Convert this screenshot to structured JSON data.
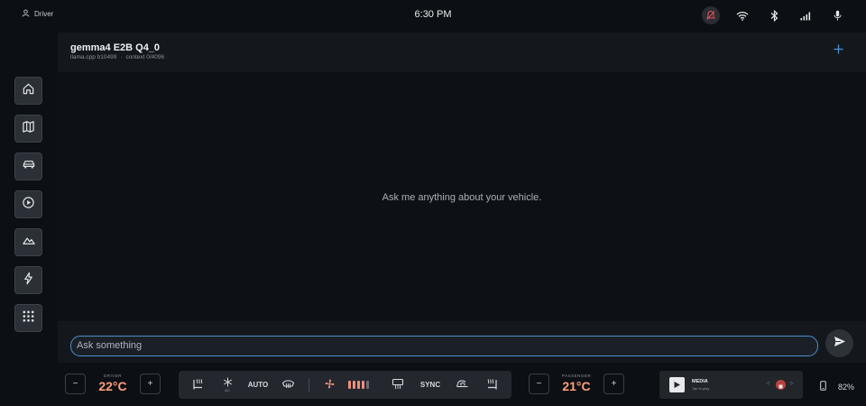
{
  "status": {
    "driver_label": "Driver",
    "time": "6:30 PM",
    "icons": [
      "user-icon",
      "alert-icon",
      "wifi-icon",
      "bluetooth-icon",
      "signal-icon",
      "mic-icon"
    ]
  },
  "sidebar": {
    "items": [
      {
        "icon": "home-icon"
      },
      {
        "icon": "map-icon"
      },
      {
        "icon": "car-icon"
      },
      {
        "icon": "play-icon"
      },
      {
        "icon": "mountain-icon"
      },
      {
        "icon": "bolt-icon"
      },
      {
        "icon": "apps-grid-icon"
      }
    ]
  },
  "chat": {
    "model_name": "gemma4 E2B Q4_0",
    "engine": "llama.cpp b10499",
    "separator": "·",
    "context": "context 0/4096",
    "empty_message": "Ask me anything about your vehicle.",
    "input_placeholder": "Ask something"
  },
  "climate": {
    "driver_label": "DRIVER",
    "driver_temp": "22°C",
    "passenger_label": "PASSENGER",
    "passenger_temp": "21°C",
    "minus": "−",
    "plus": "+",
    "auto_label": "AUTO",
    "sync_label": "SYNC",
    "ac_label": "A/C",
    "fan_level": 4,
    "fan_max": 5,
    "accent_color": "#ff9f7a"
  },
  "media": {
    "title": "MEDIA",
    "subtitle": "Tap to play",
    "prev": "◁",
    "next": "▷"
  },
  "battery": {
    "percent": "82%"
  },
  "colors": {
    "accent_blue": "#4a8fd0",
    "alert_red": "#e05555"
  }
}
